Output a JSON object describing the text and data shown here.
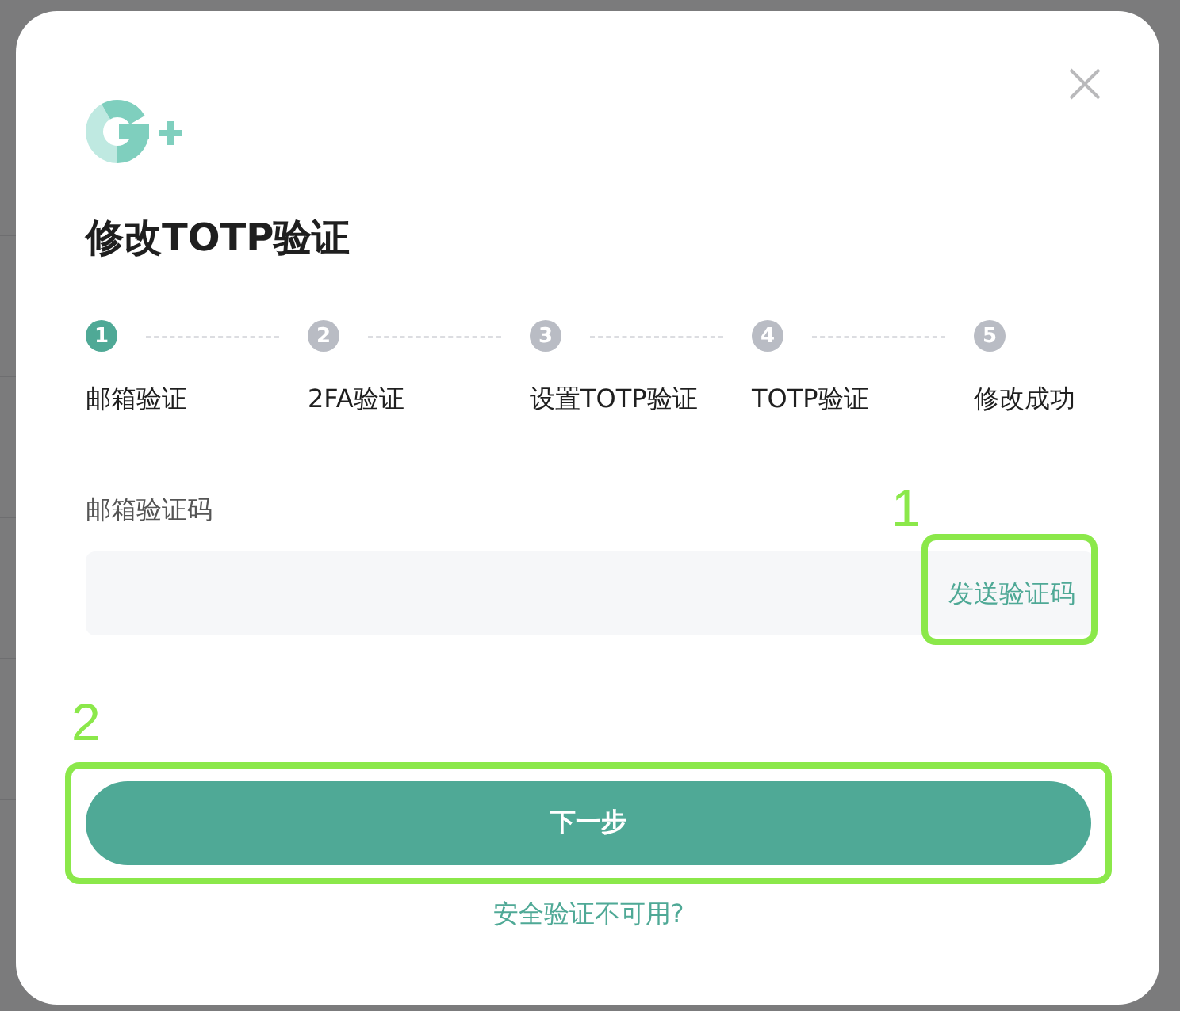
{
  "dialog": {
    "title": "修改TOTP验证",
    "steps": [
      {
        "number": "1",
        "label": "邮箱验证",
        "selected": true
      },
      {
        "number": "2",
        "label": "2FA验证",
        "selected": false
      },
      {
        "number": "3",
        "label": "设置TOTP验证",
        "selected": false
      },
      {
        "number": "4",
        "label": "TOTP验证",
        "selected": false
      },
      {
        "number": "5",
        "label": "修改成功",
        "selected": false
      }
    ],
    "email_code": {
      "label": "邮箱验证码",
      "send_button": {
        "text": "发送验证码",
        "annotation": "1"
      }
    },
    "next_button": {
      "text": "下一步",
      "annotation": "2"
    },
    "help_link": "安全验证不可用?"
  }
}
